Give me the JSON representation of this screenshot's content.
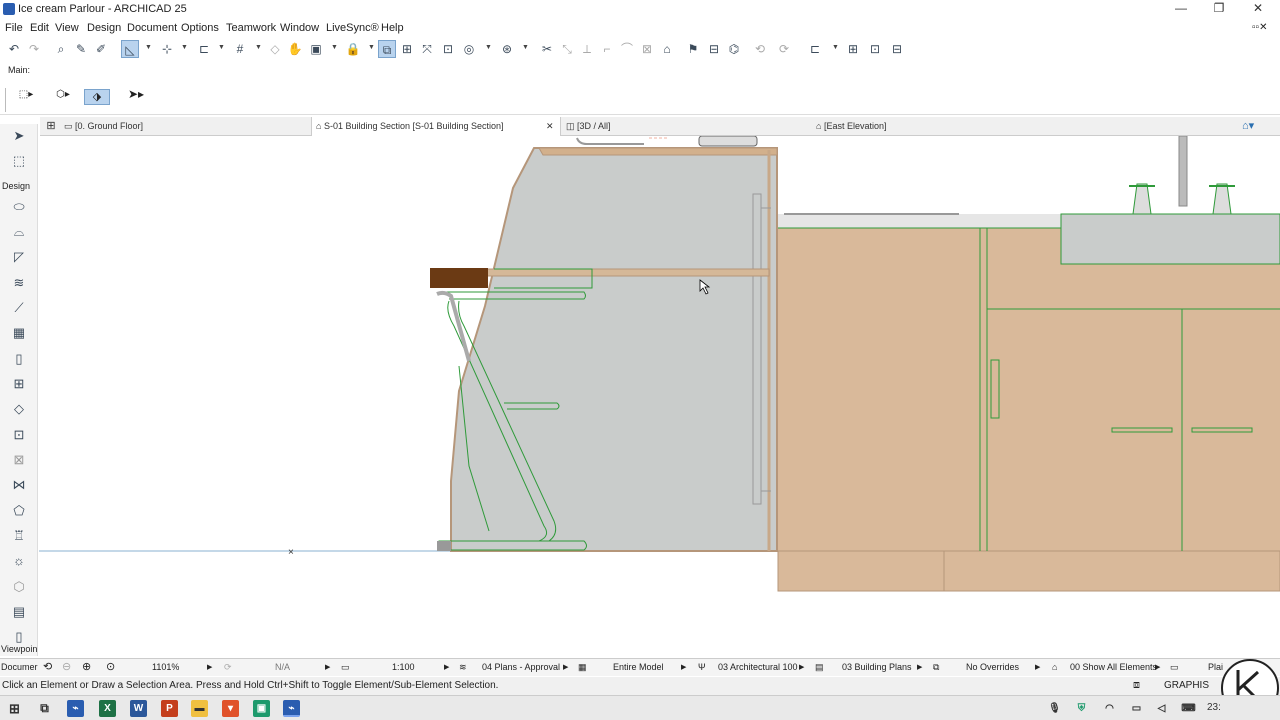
{
  "window": {
    "title": "Ice cream Parlour - ARCHICAD 25",
    "minimize": "—",
    "maximize": "❐",
    "close": "✕"
  },
  "menu": [
    "File",
    "Edit",
    "View",
    "Design",
    "Document",
    "Options",
    "Teamwork",
    "Window",
    "LiveSync®",
    "Help"
  ],
  "infobox": {
    "label": "Main:"
  },
  "tabs": [
    {
      "label": "[0. Ground Floor]"
    },
    {
      "label": "S-01 Building Section [S-01 Building Section]",
      "close": "✕"
    },
    {
      "label": "[3D / All]"
    },
    {
      "label": "[East Elevation]"
    }
  ],
  "toolbox": {
    "design_label": "Design",
    "viewpoint_label": "Viewpoin",
    "document_label": "Documer"
  },
  "navigator": {
    "zoom": "1101%",
    "angle": "N/A",
    "scale": "1:100",
    "layer_combo": "04 Plans - Approval",
    "structure": "Entire Model",
    "pen_set": "03 Architectural 100",
    "mvo": "03 Building Plans",
    "graphic_override": "No Overrides",
    "renovation": "00 Show All Elements",
    "extra": "Plai"
  },
  "status": {
    "message": "Click an Element or Draw a Selection Area. Press and Hold Ctrl+Shift to Toggle Element/Sub-Element Selection.",
    "brand": "GRAPHIS"
  },
  "taskbar": {
    "clock": "23:"
  },
  "colors": {
    "cabinet": "#d9b99a",
    "glass": "#c9cccb",
    "green_line": "#2f9a3a",
    "wood": "#6b3a14",
    "selection": "#b9d3ee"
  }
}
